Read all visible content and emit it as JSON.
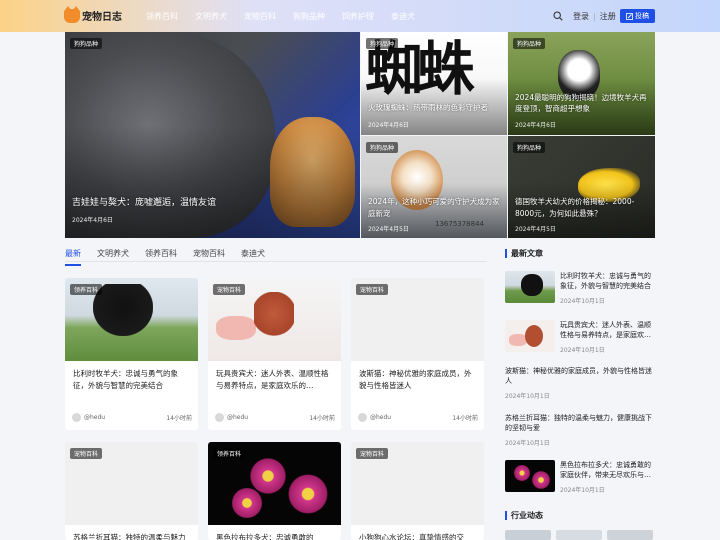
{
  "site": {
    "logo_text": "宠物日志"
  },
  "nav": [
    "领养百科",
    "文明养犬",
    "宠物百科",
    "狗狗品种",
    "饲养护理",
    "泰迪犬"
  ],
  "user": {
    "login": "登录",
    "sep": "|",
    "register": "注册",
    "post": "投稿"
  },
  "hero": [
    {
      "badge": "狗狗品种",
      "title": "吉娃娃与獒犬：庞嘘邂逅，温情友谊",
      "date": "2024年4月6日"
    },
    {
      "badge": "狗狗品种",
      "title": "火玫瑰蜘蛛：热带雨林的色彩守护者",
      "date": "2024年4月6日"
    },
    {
      "badge": "狗狗品种",
      "title": "2024最聪明的狗狗揭晓！边境牧羊犬再度登顶，智商超乎想象",
      "date": "2024年4月6日"
    },
    {
      "badge": "狗狗品种",
      "title": "2024年，这种小巧可爱的守护犬成为家庭新宠",
      "date": "2024年4月5日",
      "extra": "13675378844"
    },
    {
      "badge": "狗狗品种",
      "title": "德国牧羊犬幼犬的价格揭秘：2000-8000元，为何如此悬殊？",
      "date": "2024年4月5日"
    }
  ],
  "tabs": [
    "最新",
    "文明养犬",
    "领养百科",
    "宠物百科",
    "泰迪犬"
  ],
  "cards": [
    {
      "badge": "领养百科",
      "title": "比利时牧羊犬：忠诚与勇气的象征，外貌与智慧的完美结合",
      "author": "@hedu",
      "time": "14小时前"
    },
    {
      "badge": "宠物百科",
      "title": "玩具贵宾犬：迷人外表、温顺性格与易养特点，是家庭欢乐的…",
      "author": "@hedu",
      "time": "14小时前"
    },
    {
      "badge": "宠物百科",
      "title": "波斯猫：神秘优雅的家庭成员，外貌与性格皆迷人",
      "author": "@hedu",
      "time": "14小时前"
    },
    {
      "badge": "宠物百科",
      "title": "苏格兰折耳猫：独特的温柔与魅力"
    },
    {
      "badge": "领养百科",
      "title": "黑色拉布拉多犬：忠诚勇敢的"
    },
    {
      "badge": "宠物百科",
      "title": "小狗狗心水论坛：真挚情感的交"
    }
  ],
  "sidebar": {
    "latest_title": "最新文章",
    "latest": [
      {
        "title": "比利时牧羊犬：忠诚与勇气的象征，外貌与智慧的完美结合",
        "date": "2024年10月1日"
      },
      {
        "title": "玩具贵宾犬：迷人外表、温顺性格与易养特点，是家庭欢…",
        "date": "2024年10月1日"
      },
      {
        "title": "波斯猫：神秘优雅的家庭成员，外貌与性格皆迷人",
        "date": "2024年10月1日"
      },
      {
        "title": "苏格兰折耳猫：独特的温柔与魅力，健康挑战下的坚韧与爱",
        "date": "2024年10月1日"
      },
      {
        "title": "黑色拉布拉多犬：忠诚勇敢的家庭伙伴，带来无尽欢乐与…",
        "date": "2024年10月1日"
      }
    ],
    "industry_title": "行业动态"
  },
  "colors": {
    "accent": "#1e50e6"
  }
}
